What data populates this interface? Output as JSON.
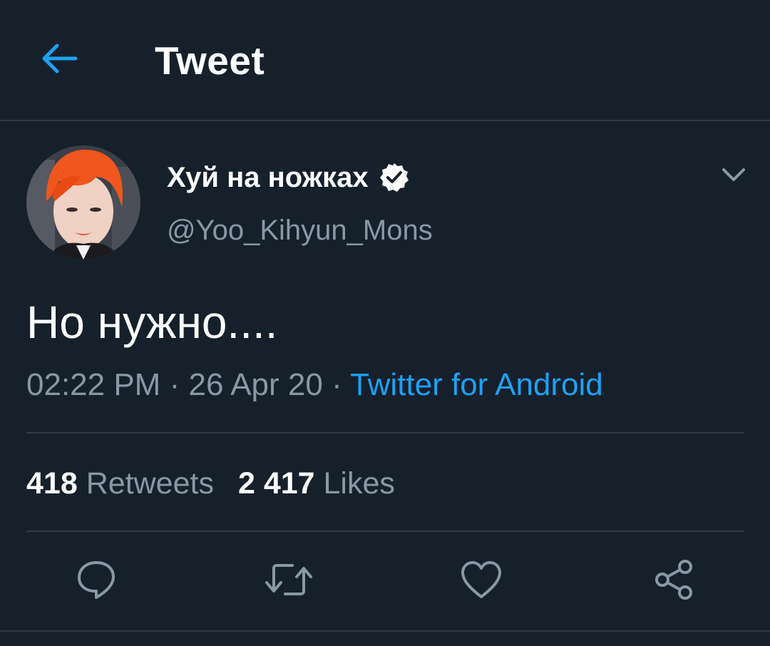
{
  "header": {
    "title": "Tweet"
  },
  "tweet": {
    "author_name": "Хуй на ножках",
    "author_handle": "@Yoo_Kihyun_Mons",
    "text": "Но нужно....",
    "time": "02:22 PM",
    "date": "26 Apr 20",
    "separator": "·",
    "source": "Twitter for Android"
  },
  "stats": {
    "retweets_count": "418",
    "retweets_label": "Retweets",
    "likes_count": "2 417",
    "likes_label": "Likes"
  },
  "icons": {
    "back": "arrow-left-icon",
    "verified": "verified-badge-icon",
    "menu": "chevron-down-icon",
    "reply": "reply-icon",
    "retweet": "retweet-icon",
    "like": "heart-icon",
    "share": "share-icon"
  },
  "colors": {
    "background": "#16202b",
    "accent": "#1da1f2",
    "secondary_text": "#8899a6",
    "divider": "#2f3a46"
  }
}
